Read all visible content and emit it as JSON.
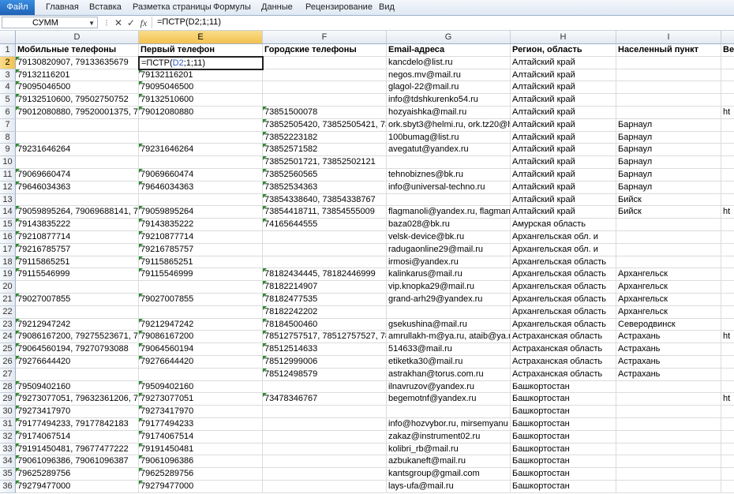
{
  "ribbon": {
    "tabs": [
      "Файл",
      "Главная",
      "Вставка",
      "Разметка страницы",
      "Формулы",
      "Данные",
      "Рецензирование",
      "Вид"
    ]
  },
  "formula_bar": {
    "name_box": "СУММ",
    "cancel_symbol": "✕",
    "enter_symbol": "✓",
    "fx_symbol": "fx",
    "formula": "=ПСТР(D2;1;11)"
  },
  "columns": [
    "D",
    "E",
    "F",
    "G",
    "H",
    "I"
  ],
  "active_cell": {
    "row": "2",
    "col": "E",
    "prefix": "=ПСТР(",
    "ref": "D2",
    "suffix": ";1;11)"
  },
  "rows": [
    {
      "n": "1",
      "D": "Мобильные телефоны",
      "E": "Первый телефон",
      "F": "Городские телефоны",
      "G": "Email-адреса",
      "H": "Регион, область",
      "I": "Населенный пункт",
      "J": "Ве"
    },
    {
      "n": "2",
      "D": "79130820907, 79133635679",
      "E": "",
      "F": "",
      "G": "kancdelo@list.ru",
      "H": "Алтайский край",
      "I": "",
      "J": ""
    },
    {
      "n": "3",
      "D": "79132116201",
      "E": "79132116201",
      "F": "",
      "G": "negos.mv@mail.ru",
      "H": "Алтайский край",
      "I": "",
      "J": ""
    },
    {
      "n": "4",
      "D": "79095046500",
      "E": "79095046500",
      "F": "",
      "G": "glagol-22@mail.ru",
      "H": "Алтайский край",
      "I": "",
      "J": ""
    },
    {
      "n": "5",
      "D": "79132510600, 79502750752",
      "E": "79132510600",
      "F": "",
      "G": "info@tdshkurenko54.ru",
      "H": "Алтайский край",
      "I": "",
      "J": ""
    },
    {
      "n": "6",
      "D": "79012080880, 79520001375, 7952",
      "E": "79012080880",
      "F": "73851500078",
      "G": "hozyaishka@mail.ru",
      "H": "Алтайский край",
      "I": "",
      "J": "ht"
    },
    {
      "n": "7",
      "D": "",
      "E": "",
      "F": "73852505420, 73852505421, 7385",
      "G": "ork.sbyt3@helmi.ru, ork.tz20@h",
      "H": "Алтайский край",
      "I": "Барнаул",
      "J": ""
    },
    {
      "n": "8",
      "D": "",
      "E": "",
      "F": "73852223182",
      "G": "100bumag@list.ru",
      "H": "Алтайский край",
      "I": "Барнаул",
      "J": ""
    },
    {
      "n": "9",
      "D": "79231646264",
      "E": "79231646264",
      "F": "73852571582",
      "G": "avegatut@yandex.ru",
      "H": "Алтайский край",
      "I": "Барнаул",
      "J": ""
    },
    {
      "n": "10",
      "D": "",
      "E": "",
      "F": "73852501721, 73852502121",
      "G": "",
      "H": "Алтайский край",
      "I": "Барнаул",
      "J": ""
    },
    {
      "n": "11",
      "D": "79069660474",
      "E": "79069660474",
      "F": "73852560565",
      "G": "tehnobiznes@bk.ru",
      "H": "Алтайский край",
      "I": "Барнаул",
      "J": ""
    },
    {
      "n": "12",
      "D": "79646034363",
      "E": "79646034363",
      "F": "73852534363",
      "G": "info@universal-techno.ru",
      "H": "Алтайский край",
      "I": "Барнаул",
      "J": ""
    },
    {
      "n": "13",
      "D": "",
      "E": "",
      "F": "73854338640, 73854338767",
      "G": "",
      "H": "Алтайский край",
      "I": "Бийск",
      "J": ""
    },
    {
      "n": "14",
      "D": "79059895264, 79069688141, 7909",
      "E": "79059895264",
      "F": "73854418711, 73854555009",
      "G": "flagmanoli@yandex.ru, flagman",
      "H": "Алтайский край",
      "I": "Бийск",
      "J": "ht"
    },
    {
      "n": "15",
      "D": "79143835222",
      "E": "79143835222",
      "F": "74165644555",
      "G": "baza028@bk.ru",
      "H": "Амурская область",
      "I": "",
      "J": ""
    },
    {
      "n": "16",
      "D": "79210877714",
      "E": "79210877714",
      "F": "",
      "G": "velsk-device@bk.ru",
      "H": "Архангельская обл. и",
      "I": "",
      "J": ""
    },
    {
      "n": "17",
      "D": "79216785757",
      "E": "79216785757",
      "F": "",
      "G": "radugaonline29@mail.ru",
      "H": "Архангельская обл. и",
      "I": "",
      "J": ""
    },
    {
      "n": "18",
      "D": "79115865251",
      "E": "79115865251",
      "F": "",
      "G": "irmosi@yandex.ru",
      "H": "Архангельская область",
      "I": "",
      "J": ""
    },
    {
      "n": "19",
      "D": "79115546999",
      "E": "79115546999",
      "F": "78182434445, 78182446999",
      "G": "kalinkarus@mail.ru",
      "H": "Архангельская область",
      "I": "Архангельск",
      "J": ""
    },
    {
      "n": "20",
      "D": "",
      "E": "",
      "F": "78182214907",
      "G": "vip.knopka29@mail.ru",
      "H": "Архангельская область",
      "I": "Архангельск",
      "J": ""
    },
    {
      "n": "21",
      "D": "79027007855",
      "E": "79027007855",
      "F": "78182477535",
      "G": "grand-arh29@yandex.ru",
      "H": "Архангельская область",
      "I": "Архангельск",
      "J": ""
    },
    {
      "n": "22",
      "D": "",
      "E": "",
      "F": "78182242202",
      "G": "",
      "H": "Архангельская область",
      "I": "Архангельск",
      "J": ""
    },
    {
      "n": "23",
      "D": "79212947242",
      "E": "79212947242",
      "F": "78184500460",
      "G": "gsekushina@mail.ru",
      "H": "Архангельская область",
      "I": "Северодвинск",
      "J": ""
    },
    {
      "n": "24",
      "D": "79086167200, 79275523671, 7927",
      "E": "79086167200",
      "F": "78512757517, 78512757527, 7851",
      "G": "amrullakh-m@ya.ru, ataib@ya.r",
      "H": "Астраханская область",
      "I": "Астрахань",
      "J": "ht"
    },
    {
      "n": "25",
      "D": "79064560194, 79270793088",
      "E": "79064560194",
      "F": "78512514633",
      "G": "514633@mail.ru",
      "H": "Астраханская область",
      "I": "Астрахань",
      "J": ""
    },
    {
      "n": "26",
      "D": "79276644420",
      "E": "79276644420",
      "F": "78512999006",
      "G": "etiketka30@mail.ru",
      "H": "Астраханская область",
      "I": "Астрахань",
      "J": ""
    },
    {
      "n": "27",
      "D": "",
      "E": "",
      "F": "78512498579",
      "G": "astrakhan@torus.com.ru",
      "H": "Астраханская область",
      "I": "Астрахань",
      "J": ""
    },
    {
      "n": "28",
      "D": "79509402160",
      "E": "79509402160",
      "F": "",
      "G": "ilnavruzov@yandex.ru",
      "H": "Башкортостан",
      "I": "",
      "J": ""
    },
    {
      "n": "29",
      "D": "79273077051, 79632361206, 7987",
      "E": "79273077051",
      "F": "73478346767",
      "G": "begemotnf@yandex.ru",
      "H": "Башкортостан",
      "I": "",
      "J": "ht"
    },
    {
      "n": "30",
      "D": "79273417970",
      "E": "79273417970",
      "F": "",
      "G": "",
      "H": "Башкортостан",
      "I": "",
      "J": ""
    },
    {
      "n": "31",
      "D": "79177494233, 79177842183",
      "E": "79177494233",
      "F": "",
      "G": "info@hozvybor.ru, mirsemyanu",
      "H": "Башкортостан",
      "I": "",
      "J": ""
    },
    {
      "n": "32",
      "D": "79174067514",
      "E": "79174067514",
      "F": "",
      "G": "zakaz@instrument02.ru",
      "H": "Башкортостан",
      "I": "",
      "J": ""
    },
    {
      "n": "33",
      "D": "79191450481, 79677477222",
      "E": "79191450481",
      "F": "",
      "G": "kolibri_rb@mail.ru",
      "H": "Башкортостан",
      "I": "",
      "J": ""
    },
    {
      "n": "34",
      "D": "79061096386, 79061096387",
      "E": "79061096386",
      "F": "",
      "G": "azbukaneft@mail.ru",
      "H": "Башкортостан",
      "I": "",
      "J": ""
    },
    {
      "n": "35",
      "D": "79625289756",
      "E": "79625289756",
      "F": "",
      "G": "kantsgroup@gmail.com",
      "H": "Башкортостан",
      "I": "",
      "J": ""
    },
    {
      "n": "36",
      "D": "79279477000",
      "E": "79279477000",
      "F": "",
      "G": "lays-ufa@mail.ru",
      "H": "Башкортостан",
      "I": "",
      "J": ""
    }
  ]
}
